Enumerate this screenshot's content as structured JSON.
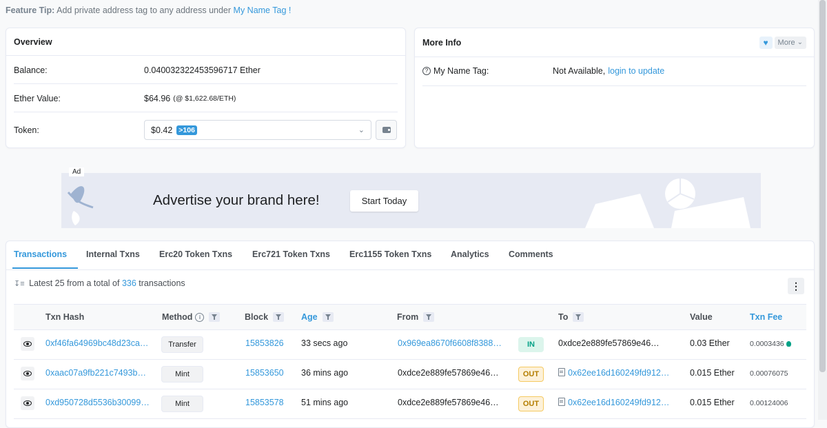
{
  "tip": {
    "label": "Feature Tip:",
    "text": "Add private address tag to any address under",
    "link": "My Name Tag",
    "suffix": "!"
  },
  "overview": {
    "title": "Overview",
    "balance_label": "Balance:",
    "balance_value": "0.040032322453596717 Ether",
    "ether_value_label": "Ether Value:",
    "ether_value": "$64.96",
    "ether_rate": "(@ $1,622.68/ETH)",
    "token_label": "Token:",
    "token_value": "$0.42",
    "token_count": ">106",
    "icons": [
      "chevron-down-icon",
      "wallet-icon"
    ]
  },
  "more_info": {
    "title": "More Info",
    "more_label": "More",
    "name_tag_label": "My Name Tag:",
    "name_tag_value": "Not Available,",
    "name_tag_link": "login to update",
    "icons": [
      "heart-icon",
      "question-circle-icon"
    ]
  },
  "ad": {
    "label": "Ad",
    "headline": "Advertise your brand here!",
    "button": "Start Today"
  },
  "tabs": [
    "Transactions",
    "Internal Txns",
    "Erc20 Token Txns",
    "Erc721 Token Txns",
    "Erc1155 Token Txns",
    "Analytics",
    "Comments"
  ],
  "summary": {
    "prefix": "Latest 25 from a total of",
    "count": "336",
    "suffix": "transactions"
  },
  "table": {
    "headers": [
      "Txn Hash",
      "Method",
      "Block",
      "Age",
      "From",
      "To",
      "Value",
      "Txn Fee"
    ],
    "rows": [
      {
        "hash": "0xf46fa64969bc48d23ca…",
        "method": "Transfer",
        "block": "15853826",
        "age": "33 secs ago",
        "from": "0x969ea8670f6608f8388…",
        "dir": "IN",
        "to": "0xdce2e889fe57869e46…",
        "value": "0.03 Ether",
        "fee": "0.0003436"
      },
      {
        "hash": "0xaac07a9fb221c7493b…",
        "method": "Mint",
        "block": "15853650",
        "age": "36 mins ago",
        "from": "0xdce2e889fe57869e46…",
        "dir": "OUT",
        "to": "0x62ee16d160249fd912…",
        "value": "0.015 Ether",
        "fee": "0.00076075"
      },
      {
        "hash": "0xd950728d5536b30099…",
        "method": "Mint",
        "block": "15853578",
        "age": "51 mins ago",
        "from": "0xdce2e889fe57869e46…",
        "dir": "OUT",
        "to": "0x62ee16d160249fd912…",
        "value": "0.015 Ether",
        "fee": "0.00124006"
      }
    ]
  },
  "colors": {
    "accent": "#3498db",
    "in": "#00a186",
    "out": "#b47d00"
  }
}
